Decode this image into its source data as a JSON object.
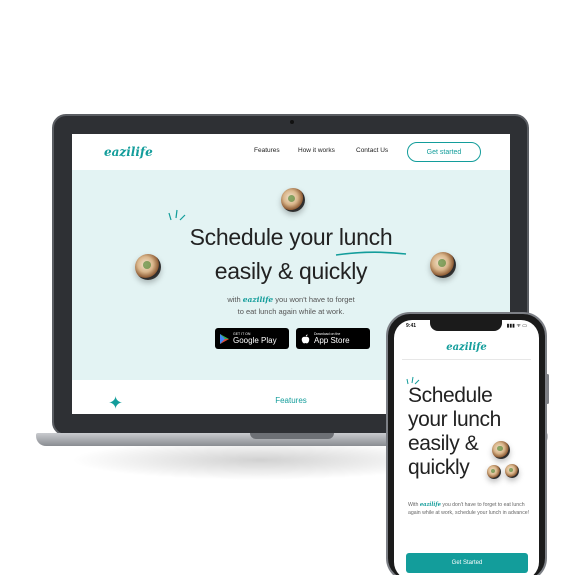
{
  "desktop": {
    "logo": "eazilife",
    "nav": {
      "features": "Features",
      "how_it_works": "How it works",
      "contact": "Contact Us"
    },
    "cta": "Get started",
    "hero": {
      "line1": "Schedule your lunch",
      "line2": "easily & quickly",
      "sub_prefix": "with",
      "sub_logo": "eazilife",
      "sub_rest": "you won't have to forget",
      "sub_line2": "to eat lunch again while at work."
    },
    "stores": {
      "google_small": "GET IT ON",
      "google_big": "Google Play",
      "apple_small": "Download on the",
      "apple_big": "App Store"
    },
    "features_title": "Features"
  },
  "mobile": {
    "time": "9:41",
    "status": "▮▮▮ ᯤ ▭",
    "logo": "eazilife",
    "hero_lines": [
      "Schedule",
      "your lunch",
      "easily &",
      "quickly"
    ],
    "sub_prefix": "With",
    "sub_logo": "eazilife",
    "sub_rest": "you don't have to forget to eat lunch again while at work, schedule your lunch in advance!",
    "cta": "Get Started"
  },
  "colors": {
    "brand": "#139d9b",
    "hero_bg": "#e3f3f3"
  },
  "icons": [
    "google-play-icon",
    "apple-icon",
    "sparkle-icon"
  ]
}
